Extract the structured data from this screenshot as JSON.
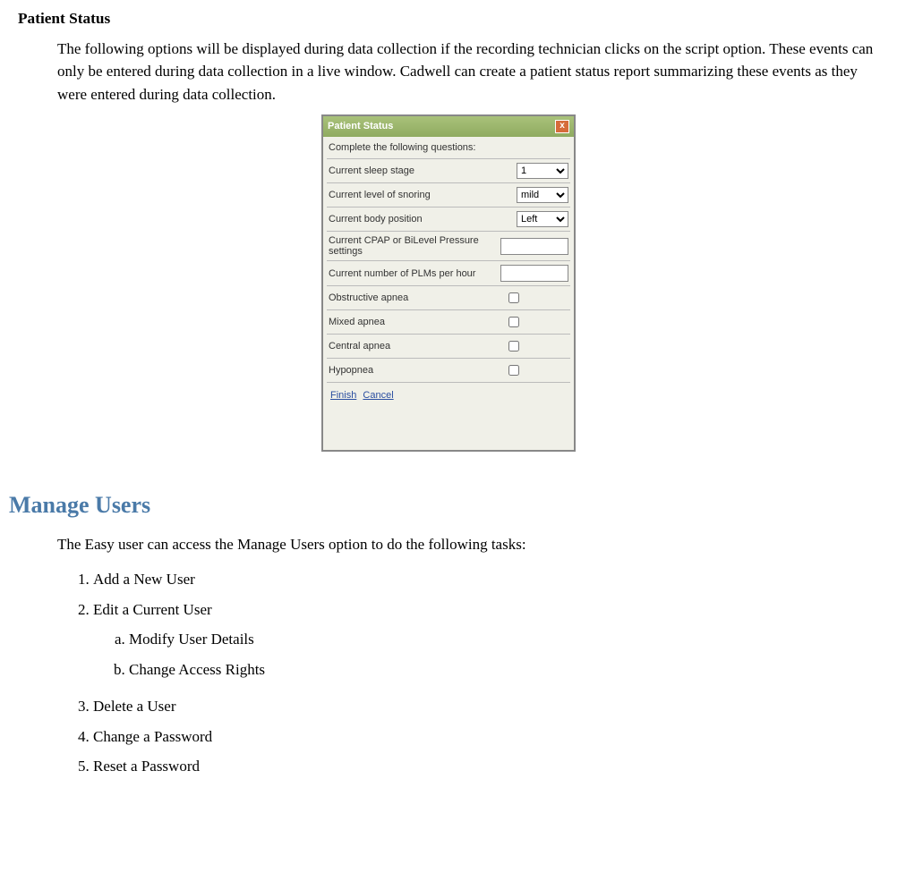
{
  "section1": {
    "title": "Patient Status",
    "para": "The following options will be displayed during data collection if the recording technician clicks on the script option.  These events can only be entered during data collection in a live window.  Cadwell can create a patient status report summarizing these events as they were entered during data collection."
  },
  "dialog": {
    "title": "Patient Status",
    "close": "x",
    "prompt": "Complete the following questions:",
    "rows": {
      "sleep_label": "Current sleep stage",
      "sleep_value": "1",
      "snoring_label": "Current level of snoring",
      "snoring_value": "mild",
      "body_label": "Current body position",
      "body_value": "Left",
      "cpap_label": "Current CPAP or BiLevel Pressure settings",
      "cpap_value": "",
      "plm_label": "Current number of PLMs per hour",
      "plm_value": "",
      "oa_label": "Obstructive apnea",
      "ma_label": "Mixed apnea",
      "ca_label": "Central apnea",
      "hy_label": "Hypopnea"
    },
    "finish": "Finish",
    "cancel": "Cancel"
  },
  "section2": {
    "title": "Manage Users",
    "para": "The Easy user can access the Manage Users option to do the following tasks:",
    "items": {
      "i1": "Add a New User",
      "i2": "Edit a Current User",
      "i2a": "Modify User Details",
      "i2b": "Change Access Rights",
      "i3": "Delete a User",
      "i4": "Change a Password",
      "i5": "Reset a Password"
    }
  }
}
